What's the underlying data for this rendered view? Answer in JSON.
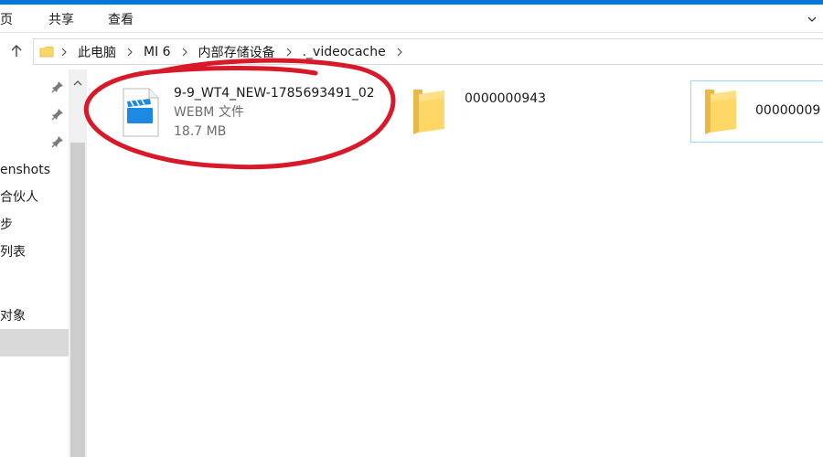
{
  "ribbon": {
    "tabs": [
      {
        "label": "主页"
      },
      {
        "label": "共享"
      },
      {
        "label": "查看"
      }
    ]
  },
  "address": {
    "crumbs": [
      "此电脑",
      "MI 6",
      "内部存储设备",
      "._videocache"
    ]
  },
  "nav": {
    "items": [
      {
        "label": "Screenshots",
        "shown": "enshots"
      },
      {
        "label": "合伙人",
        "shown": "合伙人"
      },
      {
        "label": "步",
        "shown": "步"
      },
      {
        "label": "列表",
        "shown": "列表"
      },
      {
        "label": "",
        "shown": ""
      },
      {
        "label": "对象",
        "shown": "对象"
      }
    ]
  },
  "files": [
    {
      "name": "9-9_WT4_NEW-1785693491_02",
      "type": "WEBM 文件",
      "size": "18.7 MB",
      "icon": "video-file-icon"
    },
    {
      "name": "0000000943",
      "icon": "folder-icon"
    },
    {
      "name": "00000009",
      "icon": "folder-icon"
    }
  ],
  "colors": {
    "accent": "#0078d7",
    "annotation": "#d8192a",
    "folder": "#ffd766",
    "video": "#1e88e5"
  }
}
